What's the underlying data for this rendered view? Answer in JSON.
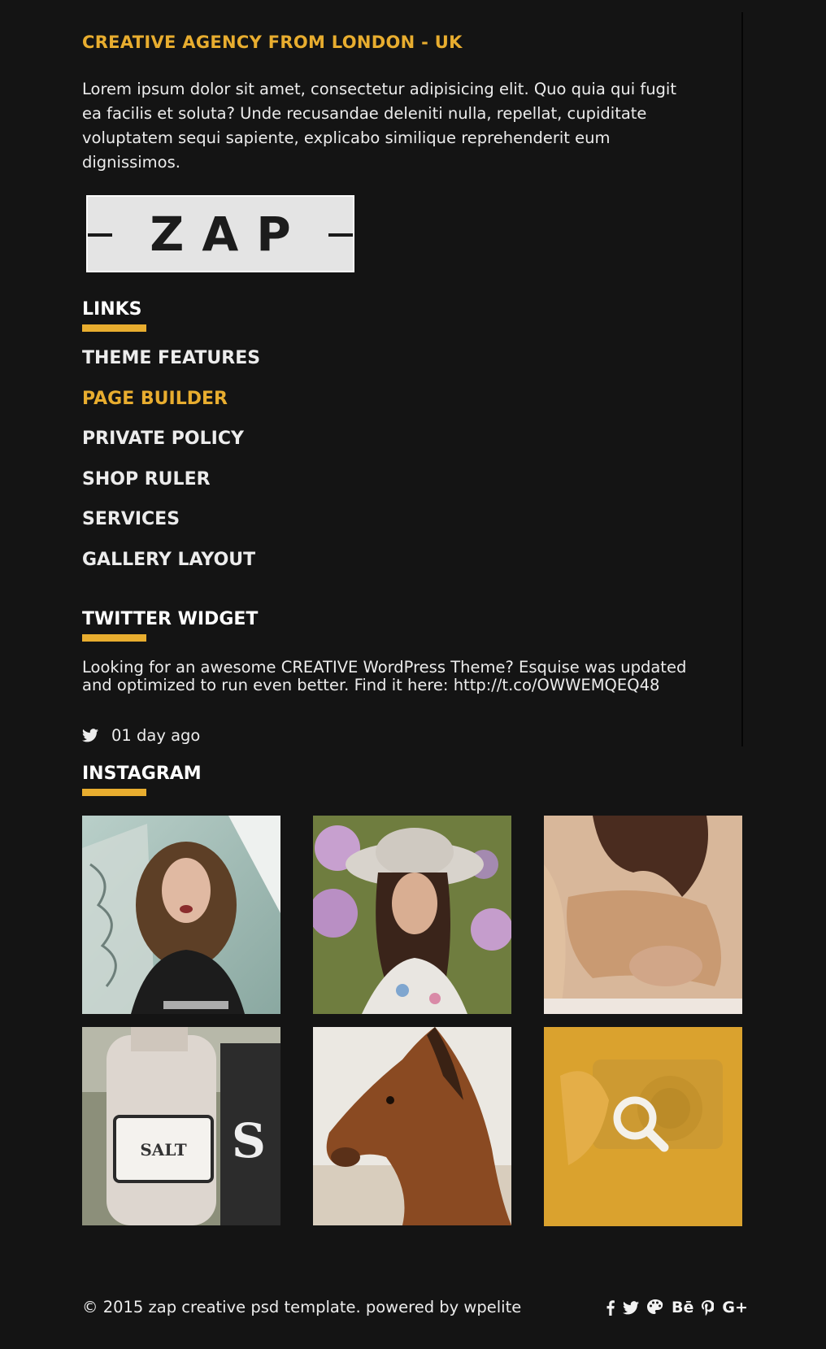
{
  "colors": {
    "accent": "#e8ad2f",
    "background": "#141414",
    "text": "#ececec"
  },
  "about": {
    "headline": "CREATIVE AGENCY FROM LONDON - UK",
    "body": "Lorem ipsum dolor sit amet, consectetur adipisicing elit. Quo quia qui fugit ea facilis et soluta? Unde recusandae deleniti nulla, repellat, cupiditate voluptatem sequi sapiente, explicabo similique reprehenderit eum dignissimos.",
    "logo_text": "ZAP"
  },
  "links": {
    "title": "LINKS",
    "items": [
      {
        "label": "THEME FEATURES",
        "active": false
      },
      {
        "label": "PAGE BUILDER",
        "active": true
      },
      {
        "label": "PRIVATE POLICY",
        "active": false
      },
      {
        "label": "SHOP RULER",
        "active": false
      },
      {
        "label": "SERVICES",
        "active": false
      },
      {
        "label": "GALLERY LAYOUT",
        "active": false
      }
    ]
  },
  "twitter": {
    "title": "TWITTER WIDGET",
    "tweet": "Looking for an awesome CREATIVE WordPress Theme? Esquise was updated and optimized to run even better. Find it here: http://t.co/OWWEMQEQ48",
    "time": "01 day ago",
    "icon": "twitter-icon"
  },
  "instagram": {
    "title": "INSTAGRAM",
    "photos": [
      "woman-curly-hair-photo",
      "woman-hat-flowers-photo",
      "floral-dress-photo",
      "salt-jar-photo",
      "horse-photo",
      "camera-photo"
    ],
    "overlay_icon": "search-icon"
  },
  "footer": {
    "copyright": "© 2015 zap creative psd template. powered by wpelite",
    "social": [
      "facebook-icon",
      "twitter-icon",
      "palette-icon",
      "behance-icon",
      "pinterest-icon",
      "google-plus-icon"
    ],
    "behance_label": "Bē",
    "gplus_label": "G+"
  }
}
